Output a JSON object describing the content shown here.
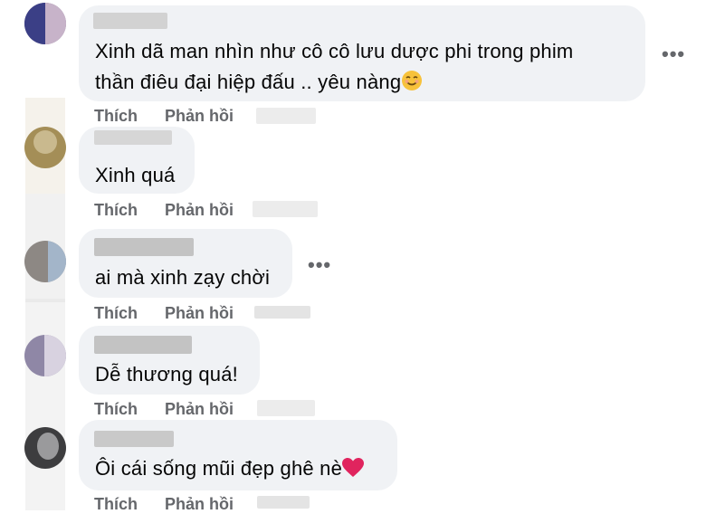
{
  "comments": [
    {
      "text_line1": "Xinh dã man nhìn như cô cô lưu dược phi trong phim",
      "text_line2": "thần điêu đại hiệp đấu .. yêu nàng",
      "like": "Thích",
      "reply": "Phản hồi",
      "emoji": "smiling-face-icon",
      "more": "•••"
    },
    {
      "text": "Xinh quá",
      "like": "Thích",
      "reply": "Phản hồi"
    },
    {
      "text": "ai mà xinh zạy chời",
      "like": "Thích",
      "reply": "Phản hồi",
      "more": "•••"
    },
    {
      "text": "Dễ thương quá!",
      "like": "Thích",
      "reply": "Phản hồi"
    },
    {
      "text": "Ôi cái sống mũi đẹp ghê nè",
      "like": "Thích",
      "reply": "Phản hồi",
      "emoji": "red-heart-icon"
    }
  ],
  "colors": {
    "bubble": "#f0f2f5",
    "text": "#050505",
    "action": "#65676b",
    "heart": "#e0245e"
  }
}
